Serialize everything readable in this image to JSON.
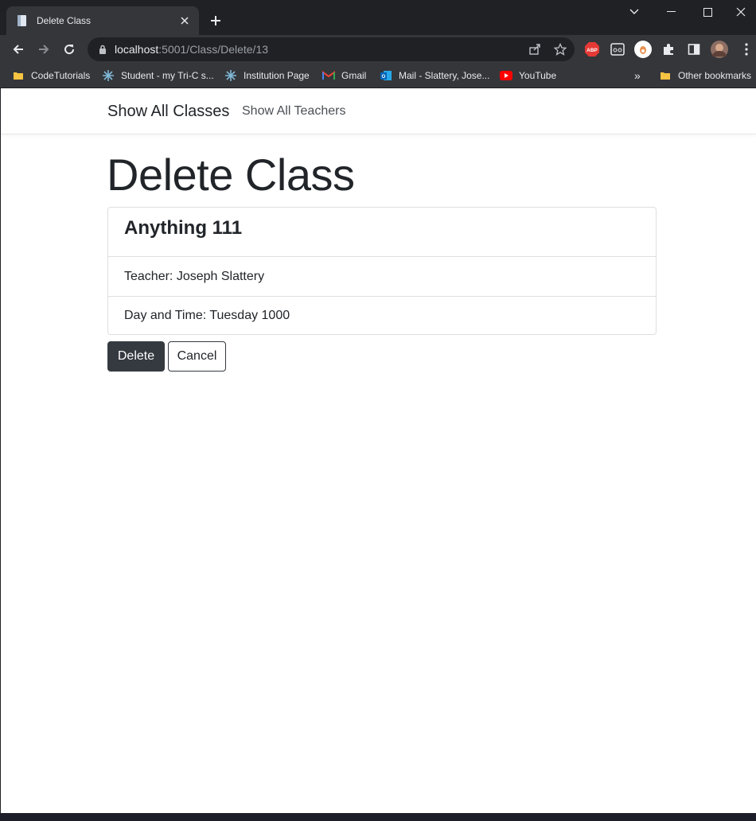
{
  "browser": {
    "tab_title": "Delete Class",
    "url_host": "localhost",
    "url_rest": ":5001/Class/Delete/13",
    "bookmarks": [
      {
        "label": "CodeTutorials",
        "icon": "folder-icon"
      },
      {
        "label": "Student - my Tri-C s...",
        "icon": "snowflake-icon"
      },
      {
        "label": "Institution Page",
        "icon": "snowflake-icon"
      },
      {
        "label": "Gmail",
        "icon": "gmail-icon"
      },
      {
        "label": "Mail - Slattery, Jose...",
        "icon": "outlook-icon"
      },
      {
        "label": "YouTube",
        "icon": "youtube-icon"
      }
    ],
    "overflow_label": "»",
    "other_bookmarks": "Other bookmarks",
    "extensions": [
      "abp-icon",
      "reader-icon",
      "profile-ext-icon",
      "puzzle-icon",
      "sidepanel-icon",
      "avatar"
    ],
    "accent_abp": "#e53935",
    "chrome_bg": "#202124",
    "toolbar_bg": "#35363a"
  },
  "site": {
    "brand": "Show All Classes",
    "nav_link": "Show All Teachers"
  },
  "page": {
    "title": "Delete Class",
    "class_name": "Anything 111",
    "teacher_line": "Teacher: Joseph Slattery",
    "schedule_line": "Day and Time: Tuesday 1000",
    "delete_label": "Delete",
    "cancel_label": "Cancel",
    "delete_color": "#343a40"
  }
}
